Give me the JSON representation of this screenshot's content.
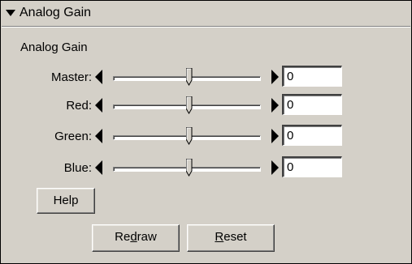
{
  "header": {
    "title": "Analog Gain",
    "expanded_icon": "triangle-down-icon"
  },
  "group": {
    "label": "Analog Gain"
  },
  "sliders": [
    {
      "label": "Master:",
      "value": "0",
      "position": 0.5
    },
    {
      "label": "Red:",
      "value": "0",
      "position": 0.5
    },
    {
      "label": "Green:",
      "value": "0",
      "position": 0.5
    },
    {
      "label": "Blue:",
      "value": "0",
      "position": 0.5
    }
  ],
  "buttons": {
    "help": "Help",
    "redraw_pre": "Re",
    "redraw_mnemonic": "d",
    "redraw_post": "raw",
    "reset_mnemonic": "R",
    "reset_post": "eset"
  },
  "colors": {
    "face": "#d4d0c8",
    "field": "#ffffff"
  }
}
